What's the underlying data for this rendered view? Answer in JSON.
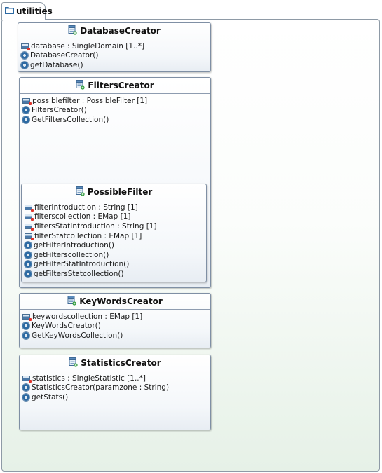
{
  "package": {
    "name": "utilities"
  },
  "classes": {
    "database_creator": {
      "name": "DatabaseCreator",
      "members": [
        {
          "kind": "field",
          "text": "database : SingleDomain [1..*]"
        },
        {
          "kind": "operation",
          "text": "DatabaseCreator()"
        },
        {
          "kind": "operation",
          "text": "getDatabase()"
        }
      ]
    },
    "filters_creator": {
      "name": "FiltersCreator",
      "members": [
        {
          "kind": "field",
          "text": "possiblefilter : PossibleFilter [1]"
        },
        {
          "kind": "operation",
          "text": "FiltersCreator()"
        },
        {
          "kind": "operation",
          "text": "GetFiltersCollection()"
        }
      ]
    },
    "possible_filter": {
      "name": "PossibleFilter",
      "members": [
        {
          "kind": "field",
          "text": "filterIntroduction : String [1]"
        },
        {
          "kind": "field",
          "text": "filterscollection : EMap [1]"
        },
        {
          "kind": "field",
          "text": "filtersStatIntroduction : String [1]"
        },
        {
          "kind": "field",
          "text": "filterStatcollection : EMap [1]"
        },
        {
          "kind": "operation",
          "text": "getFilterIntroduction()"
        },
        {
          "kind": "operation",
          "text": "getFilterscollection()"
        },
        {
          "kind": "operation",
          "text": "getFilterStatIntroduction()"
        },
        {
          "kind": "operation",
          "text": "getFiltersStatcollection()"
        }
      ]
    },
    "keywords_creator": {
      "name": "KeyWordsCreator",
      "members": [
        {
          "kind": "field",
          "text": "keywordscollection : EMap [1]"
        },
        {
          "kind": "operation",
          "text": "KeyWordsCreator()"
        },
        {
          "kind": "operation",
          "text": "GetKeyWordsCollection()"
        }
      ]
    },
    "statistics_creator": {
      "name": "StatisticsCreator",
      "members": [
        {
          "kind": "field",
          "text": "statistics : SingleStatistic [1..*]"
        },
        {
          "kind": "operation",
          "text": "StatisticsCreator(paramzone : String)"
        },
        {
          "kind": "operation",
          "text": "getStats()"
        }
      ]
    }
  }
}
